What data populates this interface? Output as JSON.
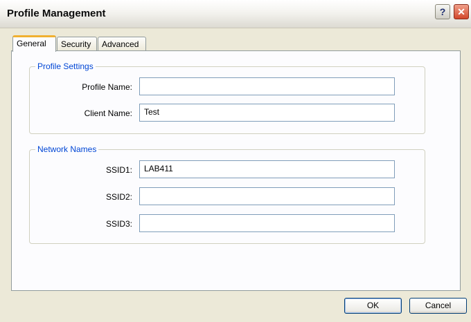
{
  "window": {
    "title": "Profile Management"
  },
  "titlebar": {
    "help_glyph": "?",
    "close_glyph": "✕"
  },
  "tabs": [
    {
      "label": "General",
      "active": true
    },
    {
      "label": "Security",
      "active": false
    },
    {
      "label": "Advanced",
      "active": false
    }
  ],
  "profile_settings": {
    "legend": "Profile Settings",
    "profile_name_label": "Profile Name:",
    "profile_name_value": "",
    "client_name_label": "Client Name:",
    "client_name_value": "Test"
  },
  "network_names": {
    "legend": "Network Names",
    "ssid1_label": "SSID1:",
    "ssid1_value": "LAB411",
    "ssid2_label": "SSID2:",
    "ssid2_value": "",
    "ssid3_label": "SSID3:",
    "ssid3_value": ""
  },
  "buttons": {
    "ok": "OK",
    "cancel": "Cancel"
  },
  "colors": {
    "legend": "#0046d5",
    "active_tab_accent": "#f0b030",
    "close_button": "#d2462a"
  }
}
